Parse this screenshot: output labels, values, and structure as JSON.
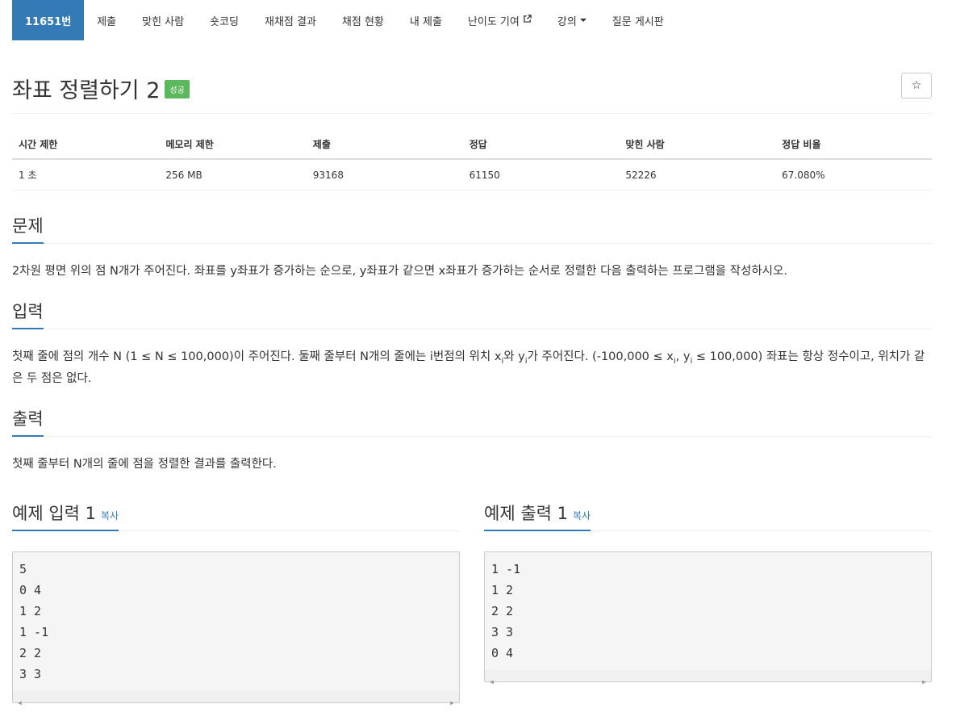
{
  "nav": {
    "items": [
      {
        "label": "11651번",
        "active": true
      },
      {
        "label": "제출"
      },
      {
        "label": "맞힌 사람"
      },
      {
        "label": "숏코딩"
      },
      {
        "label": "재채점 결과"
      },
      {
        "label": "채점 현황"
      },
      {
        "label": "내 제출"
      },
      {
        "label": "난이도 기여",
        "icon": "external-link-icon"
      },
      {
        "label": "강의",
        "icon": "caret-down-icon"
      },
      {
        "label": "질문 게시판"
      }
    ]
  },
  "problem": {
    "title": "좌표 정렬하기 2",
    "badge": "성공",
    "star": "☆"
  },
  "stats": {
    "headers": [
      "시간 제한",
      "메모리 제한",
      "제출",
      "정답",
      "맞힌 사람",
      "정답 비율"
    ],
    "values": [
      "1 초",
      "256 MB",
      "93168",
      "61150",
      "52226",
      "67.080%"
    ]
  },
  "sections": {
    "description": {
      "heading": "문제",
      "text": "2차원 평면 위의 점 N개가 주어진다. 좌표를 y좌표가 증가하는 순으로, y좌표가 같으면 x좌표가 증가하는 순서로 정렬한 다음 출력하는 프로그램을 작성하시오."
    },
    "input": {
      "heading": "입력",
      "text_1": "첫째 줄에 점의 개수 N (1 ≤ N ≤ 100,000)이 주어진다. 둘째 줄부터 N개의 줄에는 i번점의 위치 x",
      "sub_1": "i",
      "text_2": "와 y",
      "sub_2": "i",
      "text_3": "가 주어진다. (-100,000 ≤ x",
      "sub_3": "i",
      "text_4": ", y",
      "sub_4": "i",
      "text_5": " ≤ 100,000) 좌표는 항상 정수이고, 위치가 같은 두 점은 없다."
    },
    "output": {
      "heading": "출력",
      "text": "첫째 줄부터 N개의 줄에 점을 정렬한 결과를 출력한다."
    }
  },
  "samples": {
    "input": {
      "heading": "예제 입력 1",
      "copy": "복사",
      "content": "5\n0 4\n1 2\n1 -1\n2 2\n3 3"
    },
    "output": {
      "heading": "예제 출력 1",
      "copy": "복사",
      "content": "1 -1\n1 2\n2 2\n3 3\n0 4"
    }
  },
  "colors": {
    "accent": "#337ab7",
    "success": "#5cb85c"
  }
}
